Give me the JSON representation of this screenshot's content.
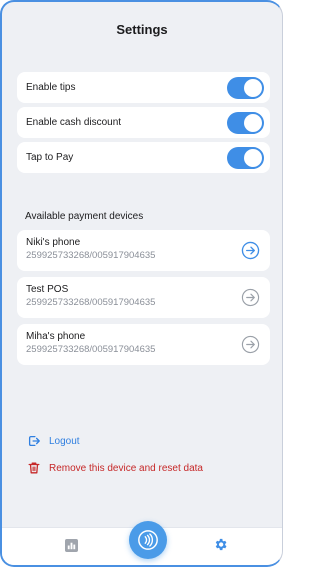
{
  "header": {
    "title": "Settings"
  },
  "toggles": [
    {
      "label": "Enable tips",
      "enabled": true
    },
    {
      "label": "Enable cash discount",
      "enabled": true
    },
    {
      "label": "Tap to Pay",
      "enabled": true
    }
  ],
  "payment_devices": {
    "section_title": "Available payment devices",
    "items": [
      {
        "name": "Niki's phone",
        "id": "259925733268/005917904635",
        "arrow_icon": "arrow-right-circle-icon",
        "active": true
      },
      {
        "name": "Test POS",
        "id": "259925733268/005917904635",
        "arrow_icon": "arrow-right-circle-icon",
        "active": false
      },
      {
        "name": "Miha's phone",
        "id": "259925733268/005917904635",
        "arrow_icon": "arrow-right-circle-icon",
        "active": false
      }
    ]
  },
  "actions": {
    "logout_label": "Logout",
    "reset_label": "Remove this device and reset data"
  },
  "bottom_nav": {
    "left_icon": "bar-chart-icon",
    "center_icon": "contactless-icon",
    "right_icon": "gear-icon"
  },
  "colors": {
    "accent": "#3f8ee6",
    "danger": "#c62828",
    "background": "#eef0f4"
  }
}
